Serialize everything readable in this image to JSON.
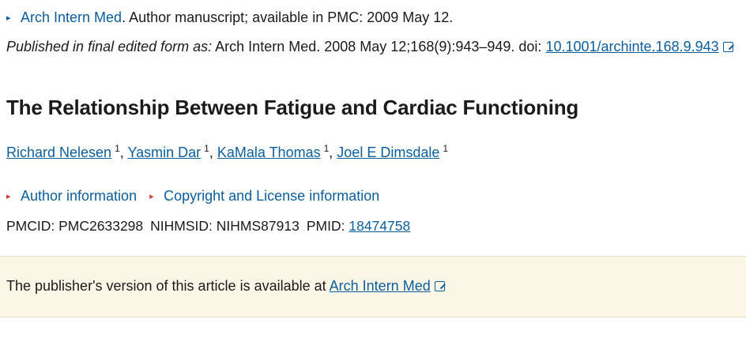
{
  "journal_line": {
    "journal_link": "Arch Intern Med",
    "rest": ". Author manuscript; available in PMC: 2009 May 12."
  },
  "published_line": {
    "prefix_italic": "Published in final edited form as:",
    "citation": "Arch Intern Med. 2008 May 12;168(9):943–949. doi:",
    "doi_link": "10.1001/archinte.168.9.943"
  },
  "title": "The Relationship Between Fatigue and Cardiac Functioning",
  "authors": [
    {
      "name": "Richard Nelesen",
      "affil": "1"
    },
    {
      "name": "Yasmin Dar",
      "affil": "1"
    },
    {
      "name": "KaMala Thomas",
      "affil": "1"
    },
    {
      "name": "Joel E Dimsdale",
      "affil": "1"
    }
  ],
  "info_links": {
    "author_info": "Author information",
    "copyright_info": "Copyright and License information"
  },
  "ids": {
    "pmcid_label": "PMCID:",
    "pmcid": "PMC2633298",
    "nihmsid_label": "NIHMSID:",
    "nihmsid": "NIHMS87913",
    "pmid_label": "PMID:",
    "pmid": "18474758"
  },
  "notice": {
    "text": "The publisher's version of this article is available at",
    "link": "Arch Intern Med"
  },
  "colors": {
    "link": "#0b5e9e",
    "accent_red": "#d83933",
    "notice_bg": "#fbf6e6"
  }
}
